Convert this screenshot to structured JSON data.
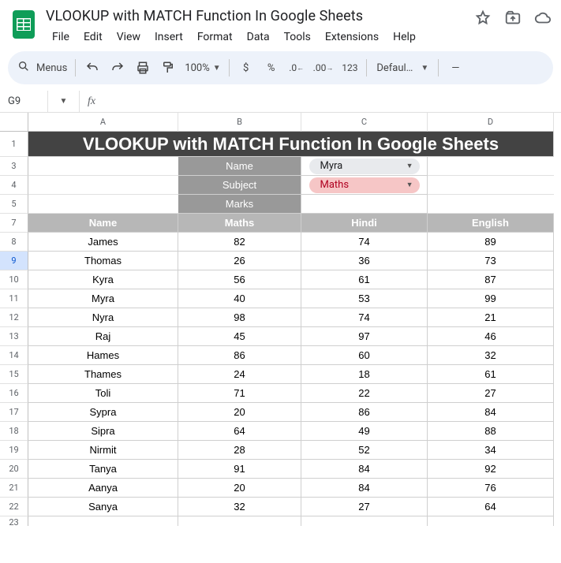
{
  "doc_title": "VLOOKUP with MATCH Function In Google Sheets",
  "menus": [
    "File",
    "Edit",
    "View",
    "Insert",
    "Format",
    "Data",
    "Tools",
    "Extensions",
    "Help"
  ],
  "toolbar": {
    "menus_label": "Menus",
    "zoom": "100%",
    "font": "Defaul…"
  },
  "namebox": "G9",
  "col_labels": [
    "A",
    "B",
    "C",
    "D"
  ],
  "banner": "VLOOKUP with MATCH Function In Google Sheets",
  "lookup": {
    "rows": [
      {
        "label": "Name",
        "value": "Myra",
        "style": "gray"
      },
      {
        "label": "Subject",
        "value": "Maths",
        "style": "red"
      },
      {
        "label": "Marks",
        "value": "",
        "style": "none"
      }
    ]
  },
  "headers": [
    "Name",
    "Maths",
    "Hindi",
    "English"
  ],
  "rows": [
    {
      "n": 8,
      "c": [
        "James",
        "82",
        "74",
        "89"
      ]
    },
    {
      "n": 9,
      "c": [
        "Thomas",
        "26",
        "36",
        "73"
      ]
    },
    {
      "n": 10,
      "c": [
        "Kyra",
        "56",
        "61",
        "87"
      ]
    },
    {
      "n": 11,
      "c": [
        "Myra",
        "40",
        "53",
        "99"
      ]
    },
    {
      "n": 12,
      "c": [
        "Nyra",
        "98",
        "74",
        "21"
      ]
    },
    {
      "n": 13,
      "c": [
        "Raj",
        "45",
        "97",
        "46"
      ]
    },
    {
      "n": 14,
      "c": [
        "Hames",
        "86",
        "60",
        "32"
      ]
    },
    {
      "n": 15,
      "c": [
        "Thames",
        "24",
        "18",
        "61"
      ]
    },
    {
      "n": 16,
      "c": [
        "Toli",
        "71",
        "22",
        "27"
      ]
    },
    {
      "n": 17,
      "c": [
        "Sypra",
        "20",
        "86",
        "84"
      ]
    },
    {
      "n": 18,
      "c": [
        "Sipra",
        "64",
        "49",
        "88"
      ]
    },
    {
      "n": 19,
      "c": [
        "Nirmit",
        "28",
        "52",
        "34"
      ]
    },
    {
      "n": 20,
      "c": [
        "Tanya",
        "91",
        "84",
        "92"
      ]
    },
    {
      "n": 21,
      "c": [
        "Aanya",
        "20",
        "84",
        "76"
      ]
    },
    {
      "n": 22,
      "c": [
        "Sanya",
        "32",
        "27",
        "64"
      ]
    }
  ]
}
